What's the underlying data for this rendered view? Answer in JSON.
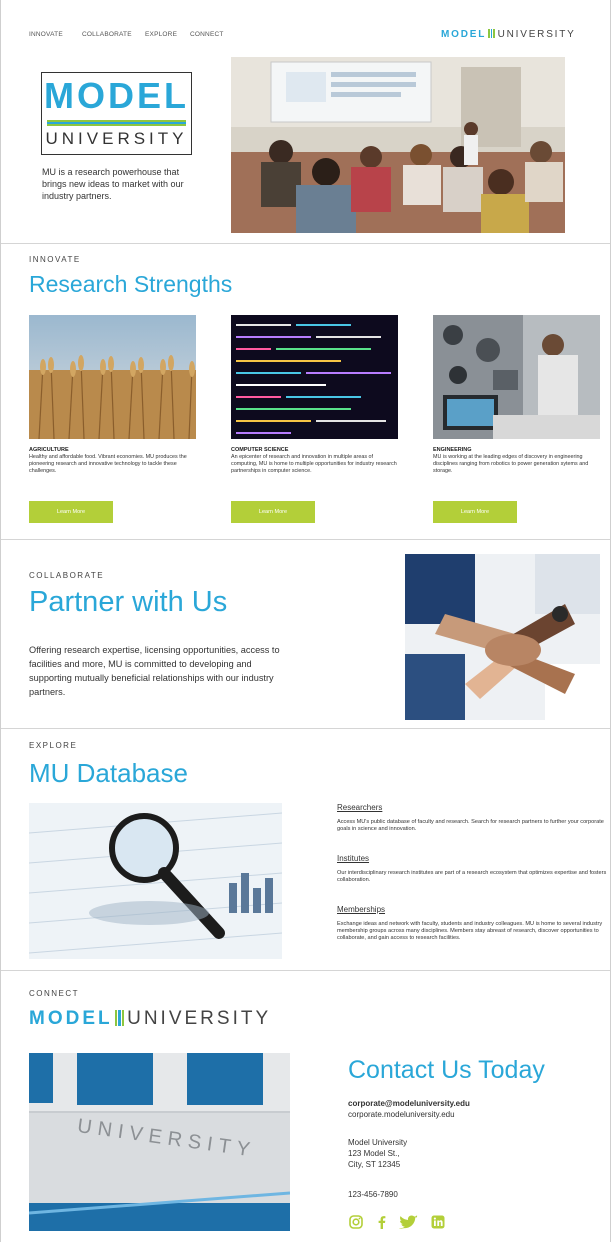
{
  "nav": {
    "items": [
      "INNOVATE",
      "COLLABORATE",
      "EXPLORE",
      "CONNECT"
    ],
    "brand_model": "MODEL",
    "brand_university": "UNIVERSITY"
  },
  "hero": {
    "logo_model": "MODEL",
    "logo_university": "UNIVERSITY",
    "tagline": "MU is a research powerhouse that brings new ideas to market with our industry partners."
  },
  "colors": {
    "accent": "#2aa7d8",
    "button": "#b3cf39",
    "stripe_green": "#8dc63f",
    "stripe_blue": "#2aa7d8"
  },
  "innovate": {
    "eyebrow": "INNOVATE",
    "title": "Research Strengths",
    "cards": [
      {
        "title": "AGRICULTURE",
        "text": "Healthy and affordable food. Vibrant economies. MU produces the pioneering research and innovative technology to tackle these challenges.",
        "button": "Learn More"
      },
      {
        "title": "COMPUTER SCIENCE",
        "text": "An epicenter of research and innovation in multiple areas of computing, MU is home to multiple opportunities for industry research partnerships in computer science.",
        "button": "Learn More"
      },
      {
        "title": "ENGINEERING",
        "text": "MU is working at the leading edges of discovery in engineering disciplines ranging from robotics to power generation sytems and storage.",
        "button": "Learn More"
      }
    ]
  },
  "collaborate": {
    "eyebrow": "COLLABORATE",
    "title": "Partner with Us",
    "text": "Offering research expertise, licensing opportunities, access to facilities and more, MU is committed to developing and supporting mutually beneficial relationships with our industry partners."
  },
  "explore": {
    "eyebrow": "EXPLORE",
    "title": "MU Database",
    "links": [
      {
        "label": "Researchers",
        "text": "Access MU's public database of faculty and research. Search for research partners to further your corporate goals in science and innovation."
      },
      {
        "label": "Institutes",
        "text": "Our interdisciplinary research institutes are part of a research ecosystem that optimizes expertise and fosters collaboration."
      },
      {
        "label": "Memberships",
        "text": "Exchange ideas and network with faculty, students and industry colleagues. MU is home to several industry membership groups across many disciplines. Members stay abreast of research, discover opportunities to collaborate, and gain access to research facilities."
      }
    ]
  },
  "connect": {
    "eyebrow": "CONNECT",
    "brand_model": "MODEL",
    "brand_university": "UNIVERSITY",
    "building_sign": "UNIVERSITY",
    "contact_title": "Contact Us Today",
    "email": "corporate@modeluniversity.edu",
    "website": "corporate.modeluniversity.edu",
    "address_name": "Model University",
    "address_street": "123 Model St.,",
    "address_city": "City, ST 12345",
    "phone": "123-456-7890",
    "social_icons": [
      "instagram-icon",
      "facebook-icon",
      "twitter-icon",
      "linkedin-icon"
    ]
  }
}
